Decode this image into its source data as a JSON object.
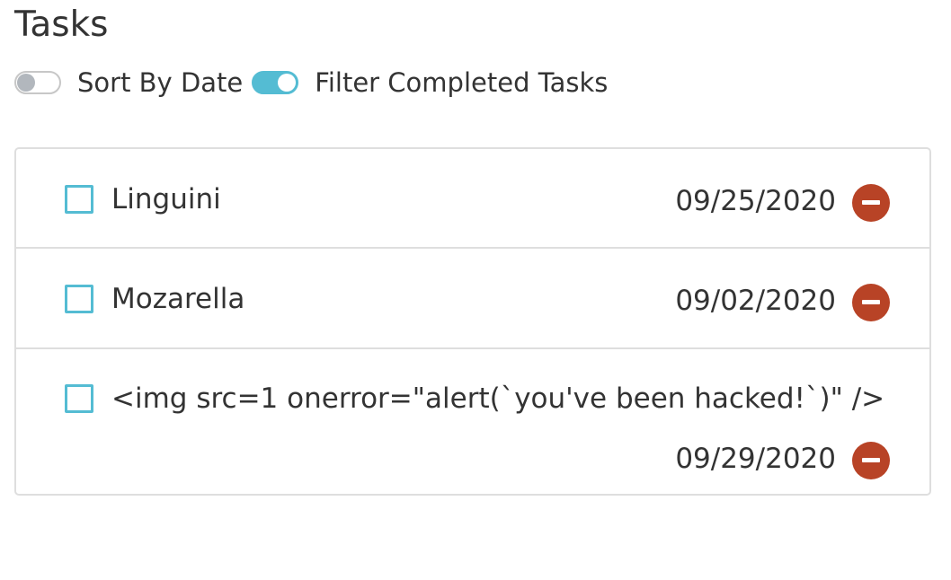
{
  "page": {
    "title": "Tasks"
  },
  "toggles": [
    {
      "label": "Sort By Date",
      "state": "off"
    },
    {
      "label": "Filter Completed Tasks",
      "state": "on"
    }
  ],
  "tasks": [
    {
      "title": "Linguini",
      "date": "09/25/2020",
      "completed": false
    },
    {
      "title": "Mozarella",
      "date": "09/02/2020",
      "completed": false
    },
    {
      "title": "<img src=1 onerror=\"alert(`you've been hacked!`)\" />",
      "date": "09/29/2020",
      "completed": false
    }
  ],
  "icons": {
    "remove": "minus-circle-icon"
  },
  "colors": {
    "accent": "#54bcd3",
    "remove": "#b84326",
    "text": "#333333",
    "border": "#dedede",
    "toggle_off_knob": "#b2b7bd"
  }
}
